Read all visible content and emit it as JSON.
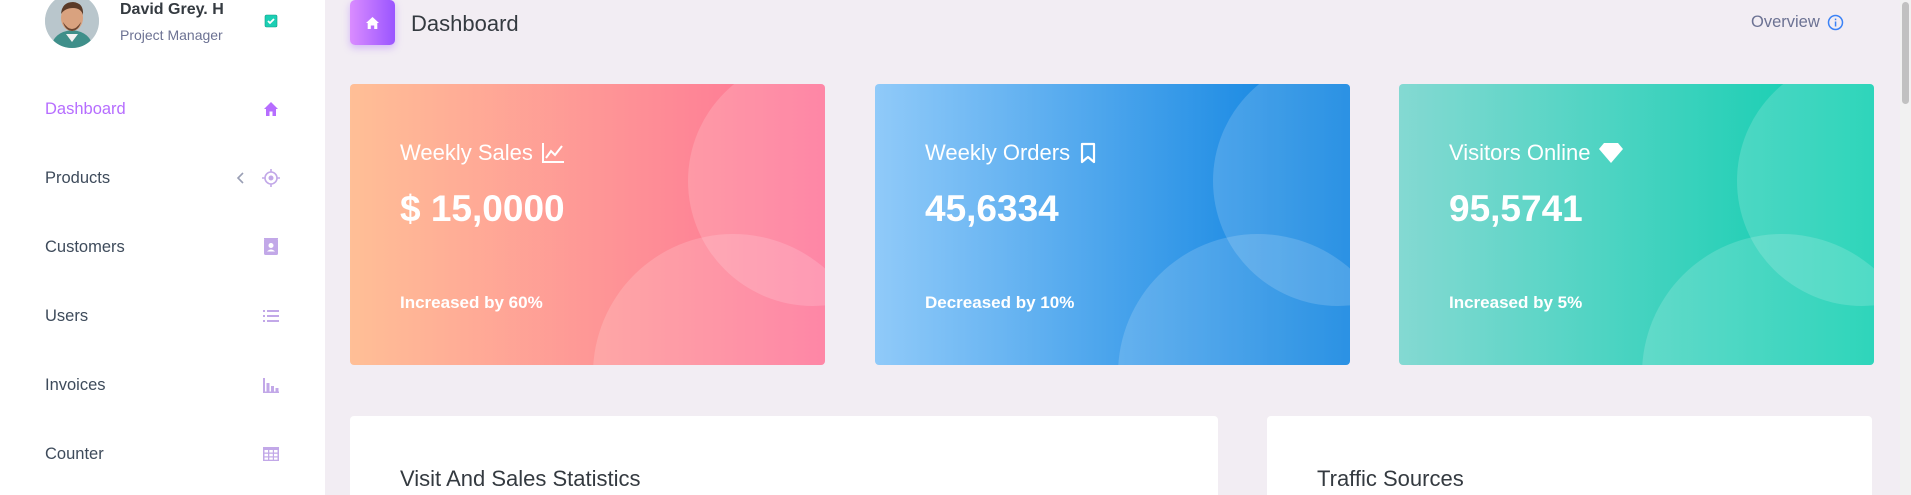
{
  "profile": {
    "name": "David Grey. H",
    "role": "Project Manager",
    "badge_icon": "check-badge-icon"
  },
  "sidebar": {
    "items": [
      {
        "label": "Dashboard",
        "icon": "home-icon",
        "active": true
      },
      {
        "label": "Products",
        "icon": "crosshair-icon",
        "has_submenu": true
      },
      {
        "label": "Customers",
        "icon": "contacts-icon"
      },
      {
        "label": "Users",
        "icon": "list-icon"
      },
      {
        "label": "Invoices",
        "icon": "bar-chart-icon"
      },
      {
        "label": "Counter",
        "icon": "grid-table-icon"
      }
    ]
  },
  "header": {
    "title": "Dashboard",
    "overview_label": "Overview"
  },
  "cards": [
    {
      "title": "Weekly Sales",
      "value": "$ 15,0000",
      "footer": "Increased by 60%",
      "icon": "chart-line-icon"
    },
    {
      "title": "Weekly Orders",
      "value": "45,6334",
      "footer": "Decreased by 10%",
      "icon": "bookmark-icon"
    },
    {
      "title": "Visitors Online",
      "value": "95,5741",
      "footer": "Increased by 5%",
      "icon": "diamond-icon"
    }
  ],
  "panels": {
    "stats_title": "Visit And Sales Statistics",
    "traffic_title": "Traffic Sources"
  },
  "colors": {
    "accent": "#b66dff",
    "sales_gradient": [
      "#ffbf96",
      "#fe7096"
    ],
    "orders_gradient": [
      "#90caf9",
      "#047edf"
    ],
    "visitors_gradient": [
      "#84d9d2",
      "#07cdae"
    ]
  }
}
